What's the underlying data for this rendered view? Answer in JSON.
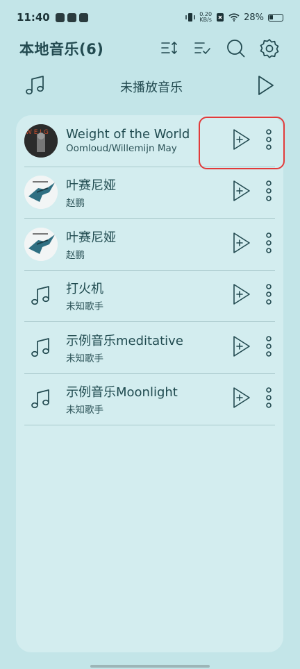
{
  "status_bar": {
    "time": "11:40",
    "net_speed_value": "0.20",
    "net_speed_unit": "KB/s",
    "battery": "28%"
  },
  "header": {
    "title": "本地音乐(6)",
    "icons": [
      "sort-icon",
      "multi-select-icon",
      "search-icon",
      "gear-icon"
    ]
  },
  "playbar": {
    "label": "未播放音乐"
  },
  "songs": [
    {
      "title": "Weight of the World",
      "artist": "Oomloud/Willemijn May",
      "thumb": "album-art-photo"
    },
    {
      "title": "叶赛尼娅",
      "artist": "赵鹏",
      "thumb": "album-art-bird"
    },
    {
      "title": "叶赛尼娅",
      "artist": "赵鹏",
      "thumb": "album-art-bird"
    },
    {
      "title": "打火机",
      "artist": "未知歌手",
      "thumb": "music-note-icon"
    },
    {
      "title": "示例音乐meditative",
      "artist": "未知歌手",
      "thumb": "music-note-icon"
    },
    {
      "title": "示例音乐Moonlight",
      "artist": "未知歌手",
      "thumb": "music-note-icon"
    }
  ],
  "colors": {
    "background": "#c3e5e8",
    "card": "#d3edef",
    "text": "#1f4a4f",
    "highlight": "#e23a3a"
  }
}
